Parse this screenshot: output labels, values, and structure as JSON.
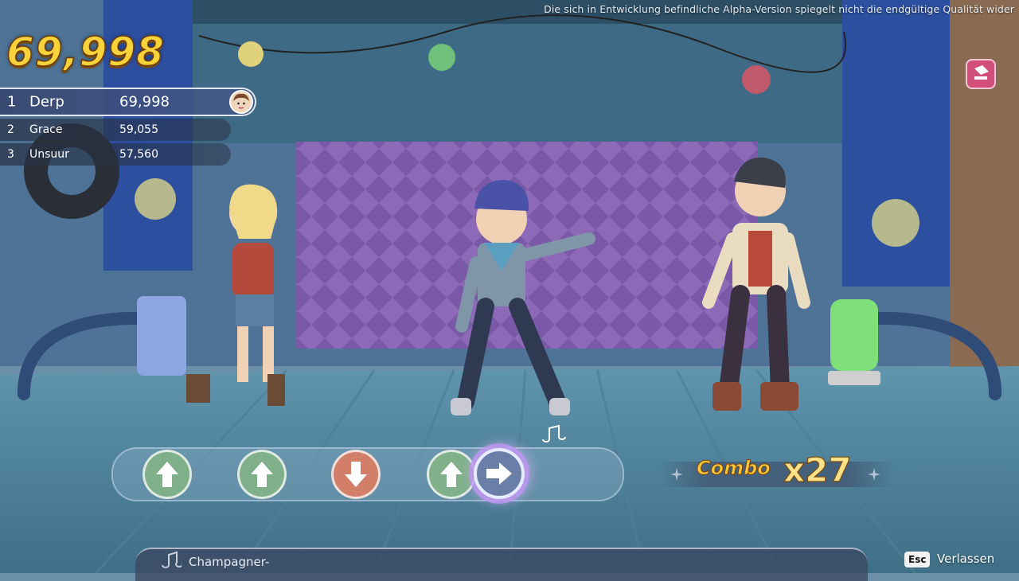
{
  "notice": "Die sich in Entwicklung befindliche Alpha-Version spiegelt nicht die endgültige Qualität wider",
  "score": {
    "total": "69,998"
  },
  "leaderboard": [
    {
      "rank": "1",
      "name": "Derp",
      "score": "69,998"
    },
    {
      "rank": "2",
      "name": "Grace",
      "score": "59,055"
    },
    {
      "rank": "3",
      "name": "Unsuur",
      "score": "57,560"
    }
  ],
  "notes": [
    {
      "direction": "up",
      "icon": "arrow-up-icon"
    },
    {
      "direction": "up",
      "icon": "arrow-up-icon"
    },
    {
      "direction": "down",
      "icon": "arrow-down-icon"
    },
    {
      "direction": "up",
      "icon": "arrow-up-icon"
    },
    {
      "direction": "right",
      "icon": "arrow-right-icon"
    }
  ],
  "combo": {
    "label": "Combo",
    "count": "x27"
  },
  "song": {
    "title": "Champagner-"
  },
  "exit": {
    "key": "Esc",
    "label": "Verlassen"
  },
  "colors": {
    "score_gold": "#f8d23a",
    "note_up": "#7fb08a",
    "note_down": "#d27f6a",
    "note_active_glow": "#c9a0f0"
  }
}
